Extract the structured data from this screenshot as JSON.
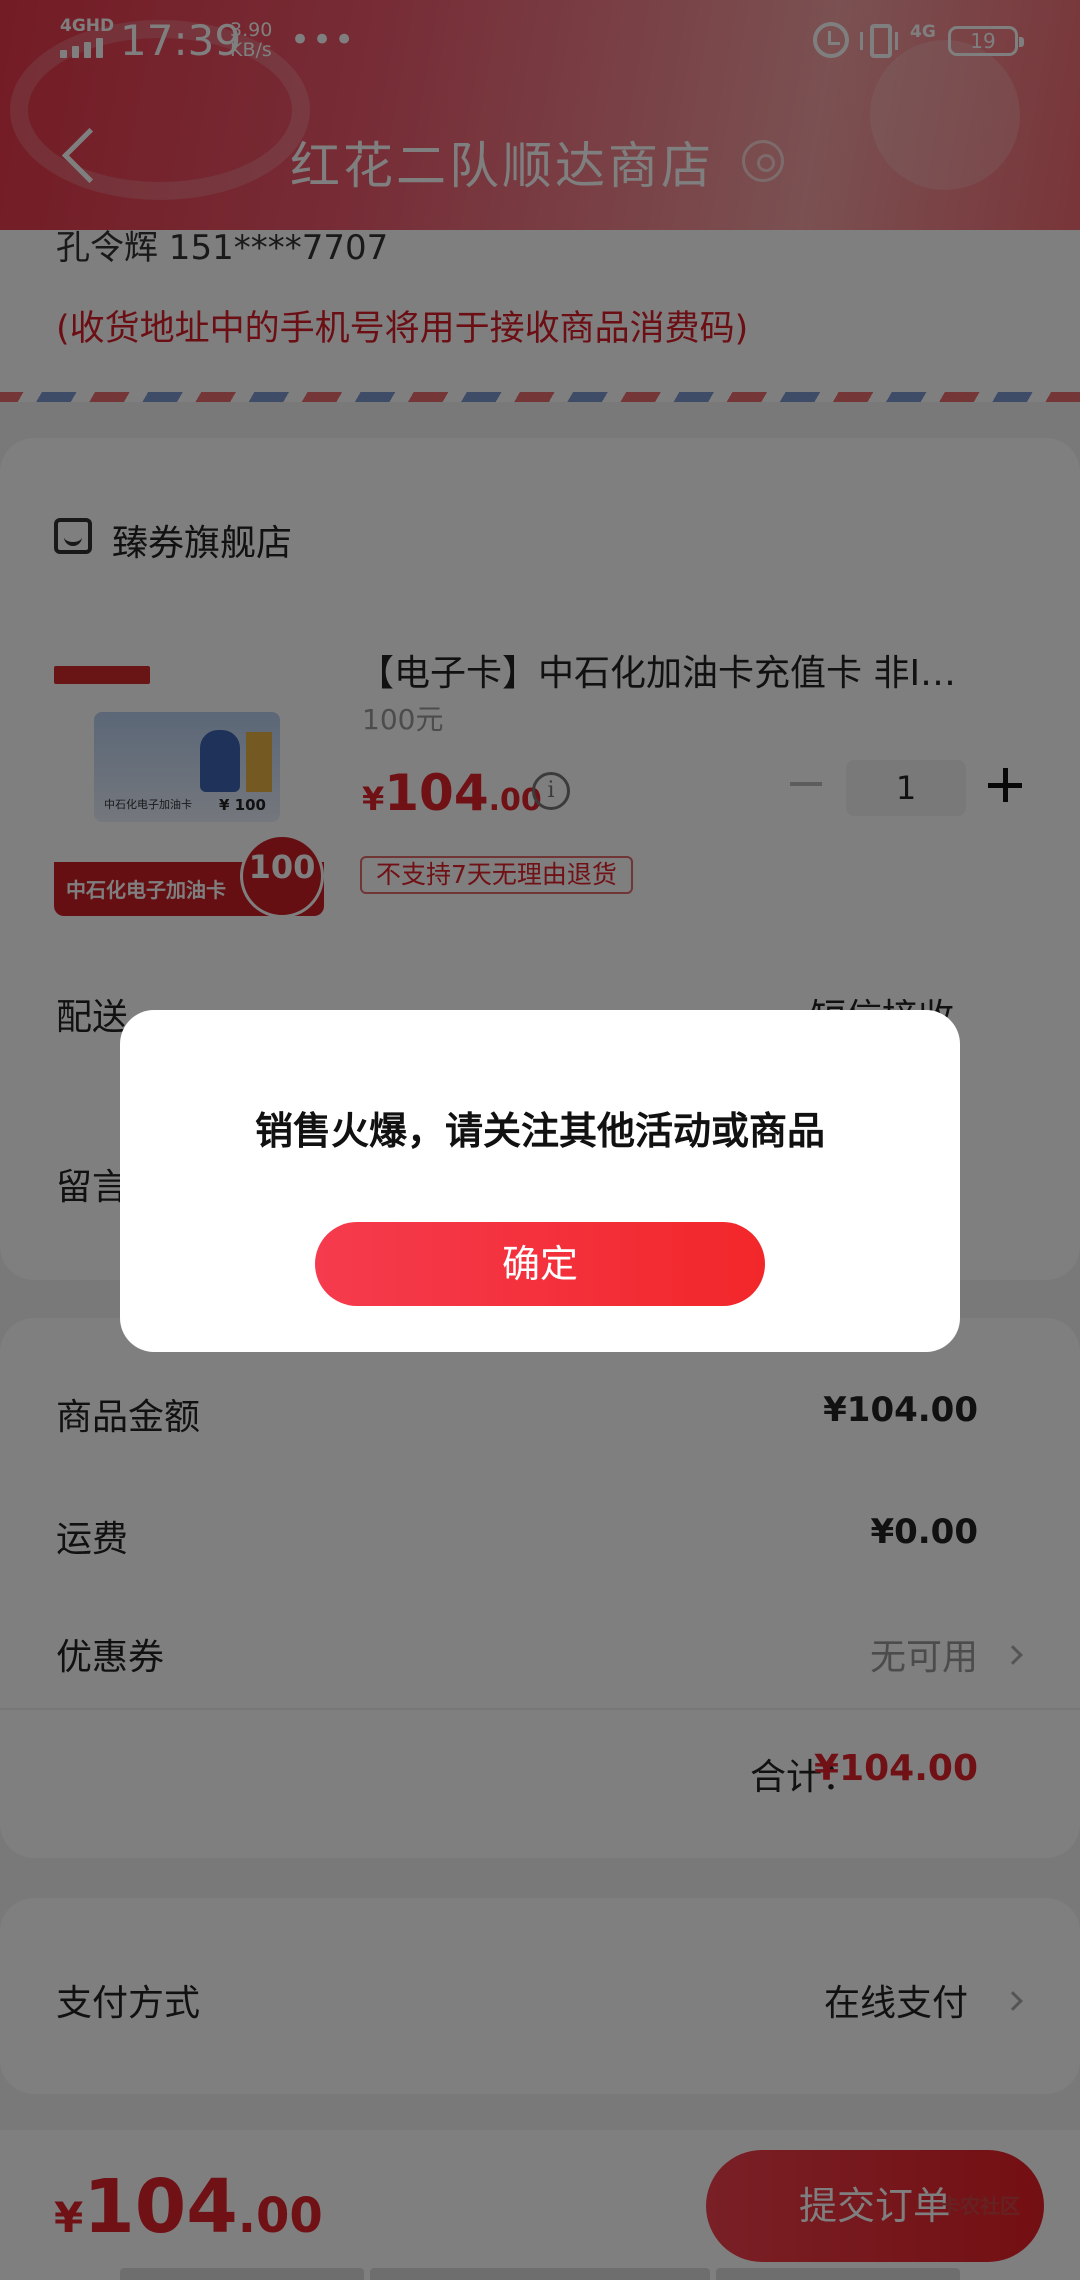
{
  "status_bar": {
    "network": "4GHD",
    "time": "17:39",
    "speed": "3.90",
    "speed_unit": "KB/s",
    "dots": "•••",
    "network_right": "4G",
    "battery": "19"
  },
  "header": {
    "title": "红花二队顺达商店"
  },
  "address": {
    "name_phone": "孔令辉  151****7707",
    "note": "(收货地址中的手机号将用于接收商品消费码)"
  },
  "store": {
    "name": "臻券旗舰店"
  },
  "product": {
    "title": "【电子卡】中石化加油卡充值卡 非I…",
    "spec": "100元",
    "price_currency": "¥",
    "price_int": "104",
    "price_dec": ".00",
    "quantity": "1",
    "tag": "不支持7天无理由退货",
    "image_label": "中石化电子加油卡",
    "image_card_text": "中石化电子加油卡",
    "image_card_amount": "¥ 100",
    "image_badge": "100"
  },
  "delivery": {
    "label": "配送",
    "value": "短信接收"
  },
  "message": {
    "label": "留言"
  },
  "summary": {
    "goods_label": "商品金额",
    "goods_value": "¥104.00",
    "shipping_label": "运费",
    "shipping_value": "¥0.00",
    "coupon_label": "优惠券",
    "coupon_value": "无可用",
    "total_label": "合计：",
    "total_value": "¥104.00"
  },
  "payment": {
    "label": "支付方式",
    "value": "在线支付"
  },
  "bottom": {
    "price_currency": "¥",
    "price_int": "104",
    "price_dec": ".00",
    "submit_label": "提交订单",
    "watermark": "卡农社区"
  },
  "dialog": {
    "message": "销售火爆，请关注其他活动或商品",
    "confirm_label": "确定"
  }
}
